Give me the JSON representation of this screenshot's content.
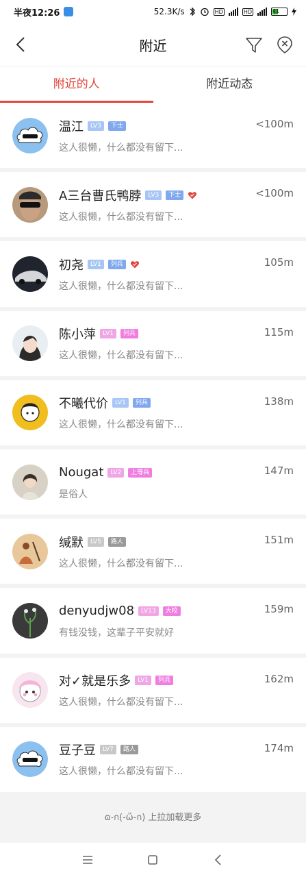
{
  "status_bar": {
    "time": "半夜12:26",
    "speed": "52.3K/s",
    "battery": "41"
  },
  "nav": {
    "title": "附近"
  },
  "tabs": [
    {
      "label": "附近的人",
      "active": true
    },
    {
      "label": "附近动态",
      "active": false
    }
  ],
  "colors": {
    "accent": "#e2453c",
    "lv_blue": "#a8c6f5",
    "rank_blue": "#7fa8ee",
    "lv_pink": "#f0a5e6",
    "rank_pink": "#f07ee0",
    "lv_gray": "#c8c8c8",
    "rank_gray": "#9a9a9a"
  },
  "users": [
    {
      "name": "温江",
      "level": "LV3",
      "rank": "下士",
      "level_color": "#a8c6f5",
      "rank_color": "#7fa8ee",
      "heart": false,
      "bio": "这人很懒，什么都没有留下...",
      "distance": "<100m",
      "avatar": "cloud-sunglasses-avatar"
    },
    {
      "name": "A三台曹氏鸭脖",
      "level": "LV3",
      "rank": "下士",
      "level_color": "#a8c6f5",
      "rank_color": "#7fa8ee",
      "heart": true,
      "bio": "这人很懒，什么都没有留下...",
      "distance": "<100m",
      "avatar": "man-sunglasses-avatar"
    },
    {
      "name": "初尧",
      "level": "LV1",
      "rank": "列兵",
      "level_color": "#a8c6f5",
      "rank_color": "#7fa8ee",
      "heart": true,
      "bio": "这人很懒，什么都没有留下...",
      "distance": "105m",
      "avatar": "car-avatar"
    },
    {
      "name": "陈小萍",
      "level": "LV1",
      "rank": "列兵",
      "level_color": "#f0a5e6",
      "rank_color": "#f07ee0",
      "heart": false,
      "bio": "这人很懒，什么都没有留下...",
      "distance": "115m",
      "avatar": "woman-avatar"
    },
    {
      "name": "不曦代价",
      "level": "LV1",
      "rank": "列兵",
      "level_color": "#a8c6f5",
      "rank_color": "#7fa8ee",
      "heart": false,
      "bio": "这人很懒，什么都没有留下...",
      "distance": "138m",
      "avatar": "cartoon-yellow-avatar"
    },
    {
      "name": "Nougat",
      "level": "LV2",
      "rank": "上等兵",
      "level_color": "#f0a5e6",
      "rank_color": "#f07ee0",
      "heart": false,
      "bio": "是俗人",
      "distance": "147m",
      "avatar": "girl-avatar"
    },
    {
      "name": "缄默",
      "level": "LV5",
      "rank": "路人",
      "level_color": "#c8c8c8",
      "rank_color": "#9a9a9a",
      "heart": false,
      "bio": "这人很懒，什么都没有留下...",
      "distance": "151m",
      "avatar": "painting-avatar"
    },
    {
      "name": "denyudjw08",
      "level": "LV13",
      "rank": "大校",
      "level_color": "#f0a5e6",
      "rank_color": "#f07ee0",
      "heart": false,
      "bio": "有钱没钱，这辈子平安就好",
      "distance": "159m",
      "avatar": "plant-dark-avatar"
    },
    {
      "name": "对✓就是乐多",
      "level": "LV1",
      "rank": "列兵",
      "level_color": "#f0a5e6",
      "rank_color": "#f07ee0",
      "heart": false,
      "bio": "这人很懒，什么都没有留下...",
      "distance": "162m",
      "avatar": "cute-girl-cartoon-avatar"
    },
    {
      "name": "豆子豆",
      "level": "LV7",
      "rank": "路人",
      "level_color": "#c8c8c8",
      "rank_color": "#9a9a9a",
      "heart": false,
      "bio": "这人很懒，什么都没有留下...",
      "distance": "174m",
      "avatar": "cloud-sunglasses-avatar"
    }
  ],
  "load_more": "ɷ˗ก(-ὤ-ก) 上拉加载更多"
}
